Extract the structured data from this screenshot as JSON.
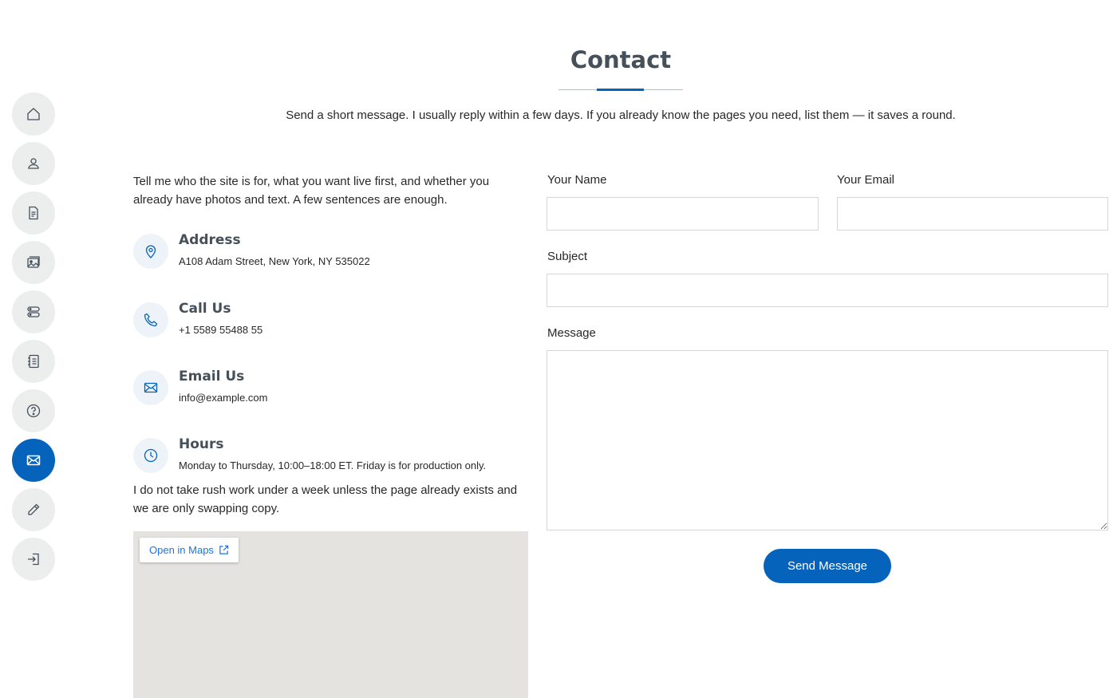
{
  "nav": {
    "items": [
      {
        "icon": "home-icon",
        "active": false
      },
      {
        "icon": "person-icon",
        "active": false
      },
      {
        "icon": "document-icon",
        "active": false
      },
      {
        "icon": "images-icon",
        "active": false
      },
      {
        "icon": "server-icon",
        "active": false
      },
      {
        "icon": "journal-list-icon",
        "active": false
      },
      {
        "icon": "question-circle-icon",
        "active": false
      },
      {
        "icon": "envelope-icon",
        "active": true
      },
      {
        "icon": "pencil-icon",
        "active": false
      },
      {
        "icon": "login-icon",
        "active": false
      }
    ]
  },
  "header": {
    "title": "Contact",
    "subtitle": "Send a short message. I usually reply within a few days. If you already know the pages you need, list them — it saves a round."
  },
  "info": {
    "intro": "Tell me who the site is for, what you want live first, and whether you already have photos and text. A few sentences are enough.",
    "address": {
      "title": "Address",
      "text": "A108 Adam Street, New York, NY 535022",
      "icon": "geo-icon"
    },
    "call": {
      "title": "Call Us",
      "text": "+1 5589 55488 55",
      "icon": "phone-icon"
    },
    "email": {
      "title": "Email Us",
      "text": "info@example.com",
      "icon": "envelope-icon"
    },
    "hours": {
      "title": "Hours",
      "text": "Monday to Thursday, 10:00–18:00 ET. Friday is for production only.",
      "icon": "clock-icon"
    },
    "note": "I do not take rush work under a week unless the page already exists and we are only swapping copy."
  },
  "map": {
    "link_label": "Open in Maps"
  },
  "form": {
    "name_label": "Your Name",
    "name_value": "",
    "email_label": "Your Email",
    "email_value": "",
    "subject_label": "Subject",
    "subject_value": "",
    "message_label": "Message",
    "message_value": "",
    "submit_label": "Send Message"
  },
  "colors": {
    "accent": "#0563bb",
    "heading": "#45505b",
    "text": "#272829"
  }
}
